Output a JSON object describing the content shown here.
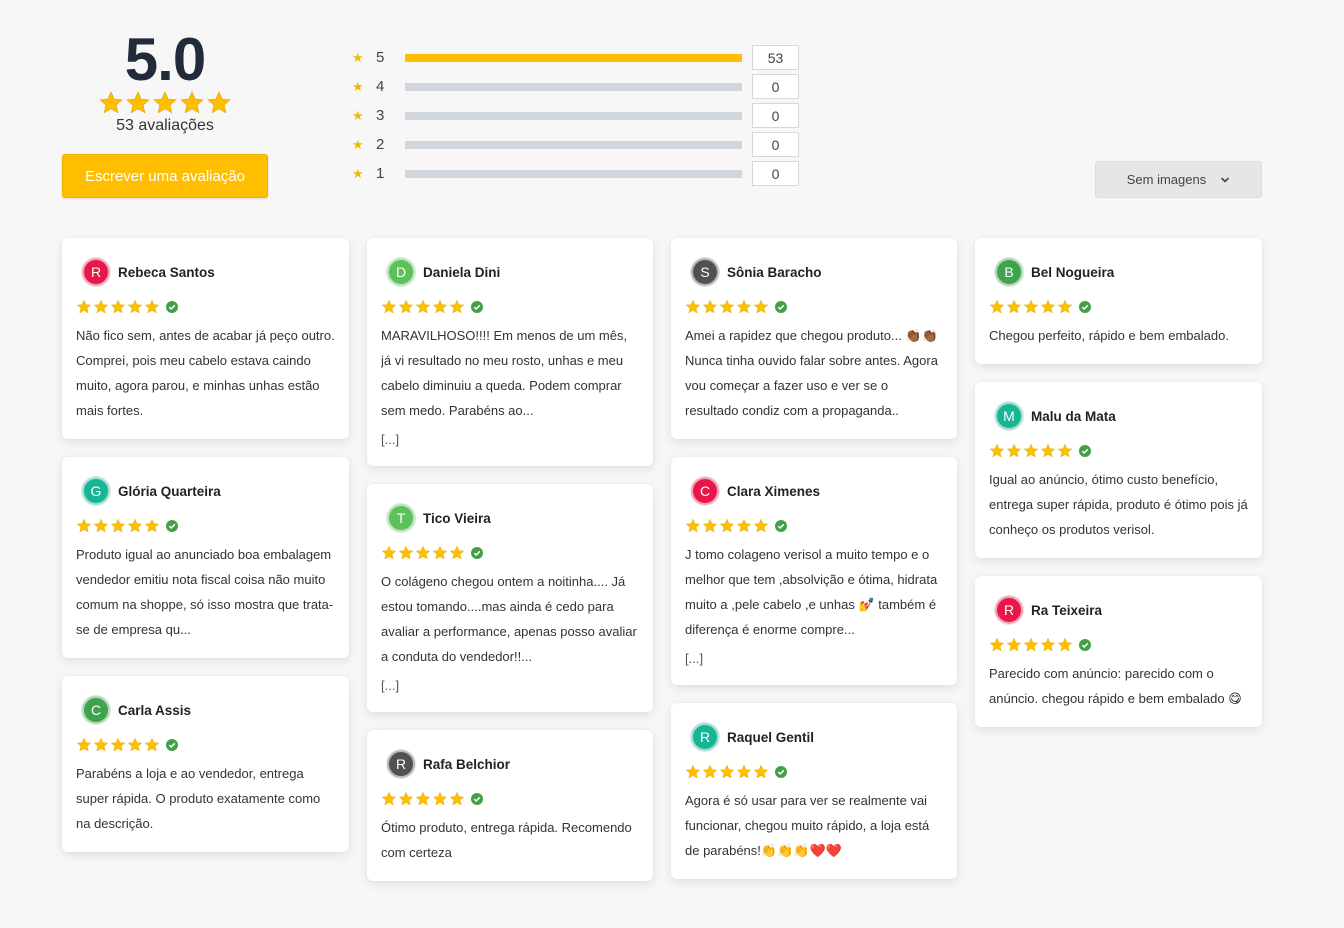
{
  "summary": {
    "average": "5.0",
    "total_label": "53 avaliações",
    "write_button": "Escrever uma avaliação"
  },
  "distribution": [
    {
      "stars": "5",
      "count": "53",
      "fraction": 1.0
    },
    {
      "stars": "4",
      "count": "0",
      "fraction": 0
    },
    {
      "stars": "3",
      "count": "0",
      "fraction": 0
    },
    {
      "stars": "2",
      "count": "0",
      "fraction": 0
    },
    {
      "stars": "1",
      "count": "0",
      "fraction": 0
    }
  ],
  "filter": {
    "label": "Sem imagens"
  },
  "colors": {
    "star": "#ffbf00",
    "verified": "#43a047"
  },
  "reviews": [
    {
      "col": 1,
      "name": "Rebeca Santos",
      "initial": "R",
      "color": "#e8174a",
      "rating": 5,
      "text": "Não fico sem, antes de acabar já peço outro. Comprei, pois meu cabelo estava caindo muito, agora parou, e minhas unhas estão mais fortes.",
      "more": ""
    },
    {
      "col": 1,
      "name": "Glória Quarteira",
      "initial": "G",
      "color": "#16b595",
      "rating": 5,
      "text": "Produto igual ao anunciado boa embalagem vendedor emitiu nota fiscal coisa não muito comum na shoppe, só isso mostra que trata-se de empresa qu...",
      "more": ""
    },
    {
      "col": 1,
      "name": "Carla Assis",
      "initial": "C",
      "color": "#3fa34d",
      "rating": 5,
      "text": "Parabéns a loja e ao vendedor, entrega super rápida. O produto exatamente como na descrição.",
      "more": ""
    },
    {
      "col": 2,
      "name": "Daniela Dini",
      "initial": "D",
      "color": "#5bc25a",
      "rating": 5,
      "text": "MARAVILHOSO!!!! Em menos de um mês, já vi resultado no meu rosto, unhas e meu cabelo diminuiu a queda. Podem comprar sem medo. Parabéns ao...",
      "more": "[...]"
    },
    {
      "col": 2,
      "name": "Tico Vieira",
      "initial": "T",
      "color": "#5bc25a",
      "rating": 5,
      "text": "O colágeno chegou ontem a noitinha.... Já estou tomando....mas ainda é cedo para avaliar a performance, apenas posso avaliar a conduta do vendedor!!...",
      "more": "[...]"
    },
    {
      "col": 2,
      "name": "Rafa Belchior",
      "initial": "R",
      "color": "#4f5152",
      "rating": 5,
      "text": "Ótimo produto, entrega rápida. Recomendo com certeza",
      "more": ""
    },
    {
      "col": 3,
      "name": "Sônia Baracho",
      "initial": "S",
      "color": "#4f5152",
      "rating": 5,
      "text": "Amei a rapidez que chegou produto... 👏🏾👏🏾 Nunca tinha ouvido falar sobre antes. Agora vou começar a fazer uso e ver se o resultado condiz com a propaganda..",
      "more": ""
    },
    {
      "col": 3,
      "name": "Clara Ximenes",
      "initial": "C",
      "color": "#e8174a",
      "rating": 5,
      "text": "J tomo colageno verisol a muito tempo e o melhor que tem ,absolvição e ótima, hidrata muito a ,pele cabelo ,e unhas 💅 também é diferença é enorme compre...",
      "more": "[...]"
    },
    {
      "col": 3,
      "name": "Raquel Gentil",
      "initial": "R",
      "color": "#16b595",
      "rating": 5,
      "text": "Agora é só usar para ver se realmente vai funcionar, chegou muito rápido, a loja está de parabéns!👏👏👏❤️❤️",
      "more": ""
    },
    {
      "col": 4,
      "name": "Bel Nogueira",
      "initial": "B",
      "color": "#3fa34d",
      "rating": 5,
      "text": "Chegou perfeito, rápido e bem embalado.",
      "more": ""
    },
    {
      "col": 4,
      "name": "Malu da Mata",
      "initial": "M",
      "color": "#16b595",
      "rating": 5,
      "text": "Igual ao anúncio, ótimo custo benefício, entrega super rápida, produto é ótimo pois já conheço os produtos verisol.",
      "more": ""
    },
    {
      "col": 4,
      "name": "Ra Teixeira",
      "initial": "R",
      "color": "#e8174a",
      "rating": 5,
      "text": "Parecido com anúncio: parecido com o anúncio. chegou rápido e bem embalado 😋",
      "more": ""
    }
  ]
}
